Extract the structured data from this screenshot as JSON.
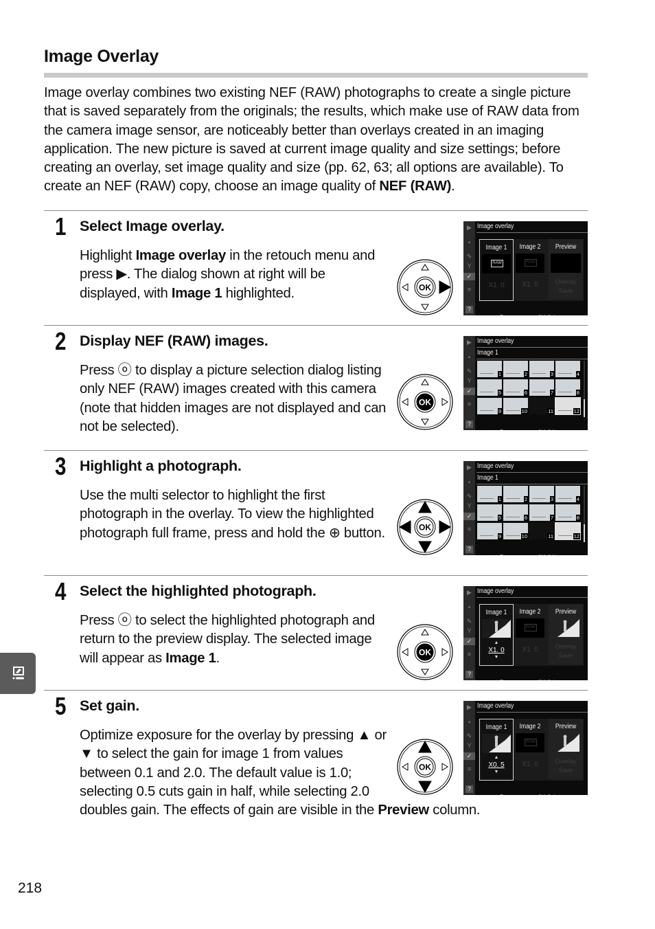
{
  "page": {
    "heading": "Image Overlay",
    "intro": [
      {
        "t": "Image overlay combines two existing NEF (RAW) photographs to create a single picture that is saved separately from the originals; the results, which make use of RAW data from the camera image sensor, are noticeably better than overlays created in an imaging application.  The new picture is saved at current image quality and size settings; before creating an overlay, set image quality and size (pp. 62, 63; all options are available).  To create an NEF (RAW) copy, choose an image quality of "
      },
      {
        "b": "NEF (RAW)"
      },
      {
        "t": "."
      }
    ],
    "page_number": "218",
    "side_tab_icon": "retouch-menu-icon"
  },
  "steps": [
    {
      "number": "1",
      "title_parts": [
        {
          "t": "Select "
        },
        {
          "b": "Image overlay"
        },
        {
          "t": "."
        }
      ],
      "body": [
        {
          "t": "Highlight "
        },
        {
          "b": "Image overlay"
        },
        {
          "t": " in the retouch menu and press ▶.  The dialog shown at right will be displayed, with "
        },
        {
          "b": "Image 1"
        },
        {
          "t": " highlighted."
        }
      ],
      "selector": {
        "pressed": [
          "right"
        ]
      },
      "screen": {
        "type": "overlay",
        "image1": "raw",
        "image1_gain": "X1. 0",
        "image2_gain": "X1. 0",
        "footer_left": "Zoom",
        "footer_right": "Select"
      }
    },
    {
      "number": "2",
      "title_parts": [
        {
          "t": "Display NEF (RAW) images."
        }
      ],
      "body": [
        {
          "t": "Press ⓞ to display a picture selection dialog listing only NEF (RAW) images created with this camera (note that hidden images are not displayed and can not be selected)."
        }
      ],
      "selector": {
        "pressed": [
          "ok"
        ]
      },
      "screen": {
        "type": "grid",
        "subtitle": "Image 1",
        "footer_left": "Zoom",
        "footer_right": "OK",
        "thumbs": [
          "1",
          "2",
          "3",
          "4",
          "5",
          "6",
          "7",
          "8",
          "9",
          "10",
          "11",
          "12"
        ],
        "selected": "12"
      }
    },
    {
      "number": "3",
      "title_parts": [
        {
          "t": "Highlight a photograph."
        }
      ],
      "body": [
        {
          "t": "Use the multi selector to highlight the first photograph in the overlay.  To view the highlighted photograph full frame, press and hold the ⊕ button."
        }
      ],
      "selector": {
        "pressed": [
          "up",
          "down",
          "left",
          "right"
        ]
      },
      "screen": {
        "type": "grid",
        "subtitle": "Image 1",
        "footer_left": "Zoom",
        "footer_right": "OK",
        "thumbs": [
          "1",
          "2",
          "3",
          "4",
          "5",
          "6",
          "7",
          "8",
          "9",
          "10",
          "11",
          "12"
        ],
        "selected": "12"
      }
    },
    {
      "number": "4",
      "title_parts": [
        {
          "t": "Select the highlighted photograph."
        }
      ],
      "body": [
        {
          "t": "Press ⓞ to select the highlighted photograph and return to the preview display.  The selected image will appear as "
        },
        {
          "b": "Image 1"
        },
        {
          "t": "."
        }
      ],
      "selector": {
        "pressed": [
          "ok"
        ]
      },
      "screen": {
        "type": "overlay",
        "image1": "photo",
        "image1_gain": "X1. 0",
        "image2_gain": "X1. 0",
        "footer_left": "Zoom",
        "footer_right": "Select"
      }
    },
    {
      "number": "5",
      "title_parts": [
        {
          "t": "Set gain."
        }
      ],
      "body": [
        {
          "t": "Optimize exposure for the overlay by pressing ▲ or ▼ to select the gain for image 1 from values between 0.1 and 2.0.  The default value is 1.0; selecting 0.5 cuts gain in half, while selecting 2.0 doubles gain.  The effects of gain are visible in the "
        },
        {
          "b": "Preview"
        },
        {
          "t": " column."
        }
      ],
      "selector": {
        "pressed": [
          "up",
          "down"
        ]
      },
      "screen": {
        "type": "overlay",
        "image1": "photo",
        "image1_gain": "X0. 5",
        "image2_gain": "X1. 0",
        "footer_left": "Zoom",
        "footer_right": "Select"
      }
    }
  ],
  "lcd": {
    "title": "Image overlay",
    "col_image1": "Image 1",
    "col_image2": "Image 2",
    "col_preview": "Preview",
    "raw_label": "RAW",
    "overlay_line1": "Overlay",
    "overlay_line2": "Save",
    "help": "?"
  }
}
